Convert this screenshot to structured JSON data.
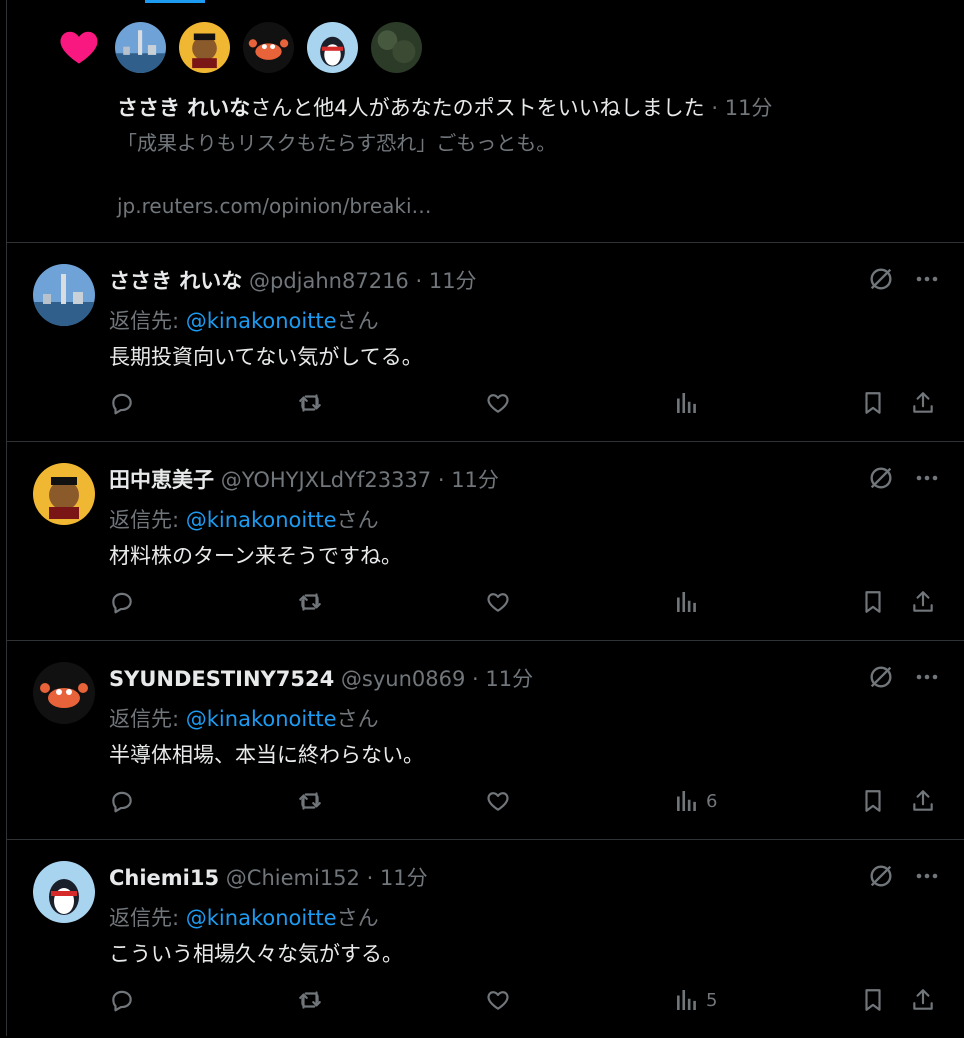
{
  "notification": {
    "liker_name": "ささき れいな",
    "message": "さんと他4人があなたのポストをいいねしました",
    "separator": " · ",
    "time": "11分",
    "quote": "「成果よりもリスクもたらす恐れ」ごもっとも。",
    "link": "jp.reuters.com/opinion/breaki…",
    "avatars": [
      "avatar-city",
      "avatar-bear",
      "avatar-crab",
      "avatar-penguin",
      "avatar-tree"
    ]
  },
  "reply_prefix": "返信先: ",
  "reply_suffix": "さん",
  "separator": " · ",
  "posts": [
    {
      "name": "ささき れいな",
      "handle": "@pdjahn87216",
      "time": "11分",
      "reply_to": "@kinakonoitte",
      "text": "長期投資向いてない気がしてる。",
      "views": "",
      "avatar": "city"
    },
    {
      "name": "田中恵美子",
      "handle": "@YOHYJXLdYf23337",
      "time": "11分",
      "reply_to": "@kinakonoitte",
      "text": "材料株のターン来そうですね。",
      "views": "",
      "avatar": "bear"
    },
    {
      "name": "SYUNDESTINY7524",
      "handle": "@syun0869",
      "time": "11分",
      "reply_to": "@kinakonoitte",
      "text": "半導体相場、本当に終わらない。",
      "views": "6",
      "avatar": "crab"
    },
    {
      "name": "Chiemi15",
      "handle": "@Chiemi152",
      "time": "11分",
      "reply_to": "@kinakonoitte",
      "text": "こういう相場久々な気がする。",
      "views": "5",
      "avatar": "penguin"
    }
  ],
  "colors": {
    "background": "#000000",
    "text": "#e7e9ea",
    "muted": "#71767b",
    "accent": "#1d9bf0",
    "like": "#f91880",
    "divider": "#2f3336"
  }
}
